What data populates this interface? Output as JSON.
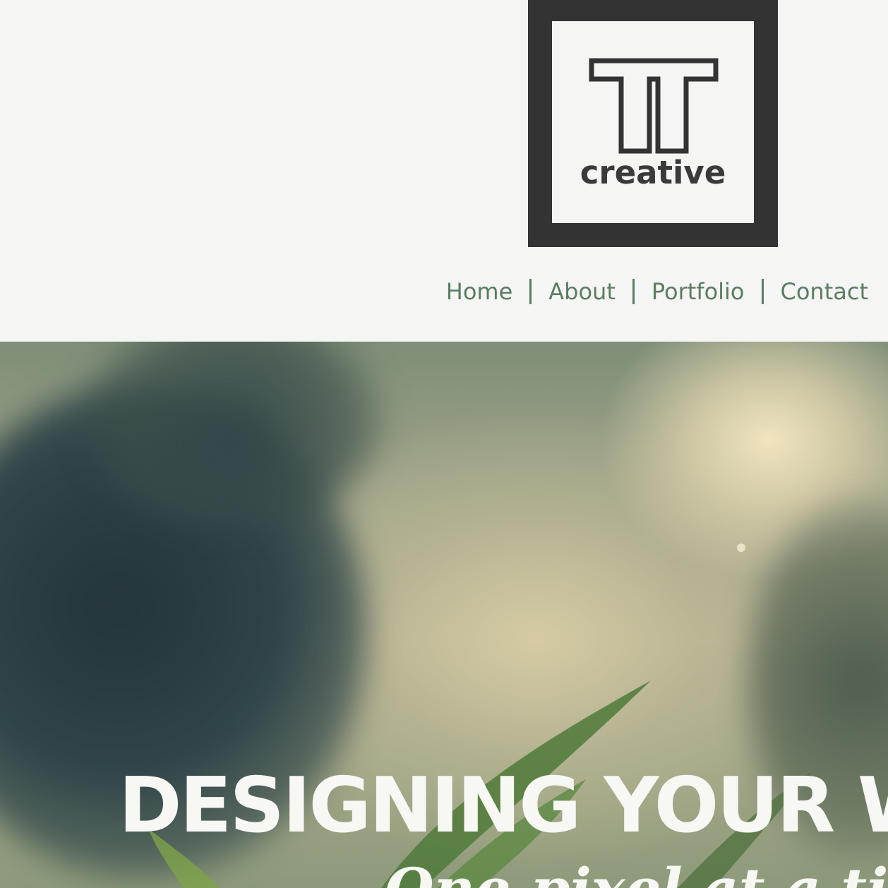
{
  "logo": {
    "wordmark": "creative",
    "mark_icon": "tt-monogram-icon"
  },
  "nav": {
    "items": [
      {
        "label": "Home"
      },
      {
        "label": "About"
      },
      {
        "label": "Portfolio"
      },
      {
        "label": "Contact"
      }
    ],
    "separator": "|"
  },
  "hero": {
    "title": "DESIGNING YOUR W",
    "subtitle": "One pixel at a tim"
  },
  "colors": {
    "background": "#f5f5f4",
    "logo_frame": "#333333",
    "nav_text": "#5b7d63",
    "hero_text": "#f7f7f4"
  }
}
